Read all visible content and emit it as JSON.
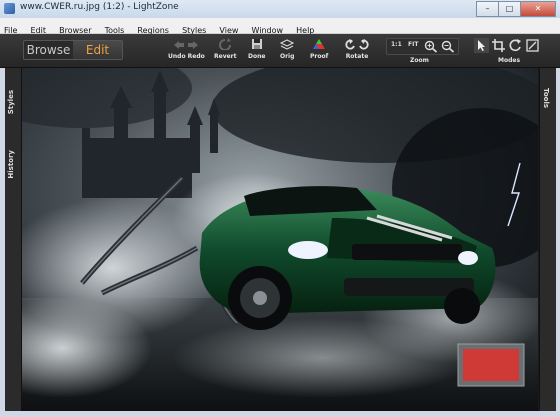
{
  "window": {
    "title": "www.CWER.ru.jpg (1:2) - LightZone",
    "minimize": "–",
    "maximize": "□",
    "close": "✕"
  },
  "menu": [
    "File",
    "Edit",
    "Browser",
    "Tools",
    "Regions",
    "Styles",
    "View",
    "Window",
    "Help"
  ],
  "mode_switch": {
    "browse": "Browse",
    "edit": "Edit"
  },
  "toolbar": {
    "undo_redo": "Undo Redo",
    "revert": "Revert",
    "done": "Done",
    "orig": "Orig",
    "proof": "Proof",
    "rotate": "Rotate",
    "zoom_one": "1:1",
    "zoom_fit": "FIT",
    "zoom": "Zoom",
    "modes": "Modes"
  },
  "side_tabs": {
    "styles": "Styles",
    "history": "History",
    "tools": "Tools"
  },
  "image": {
    "description_icon": "photo-car-chains"
  },
  "colors": {
    "accent": "#f1a23a",
    "toolbar": "#2f2f2f",
    "background": "#1a1a1a"
  }
}
